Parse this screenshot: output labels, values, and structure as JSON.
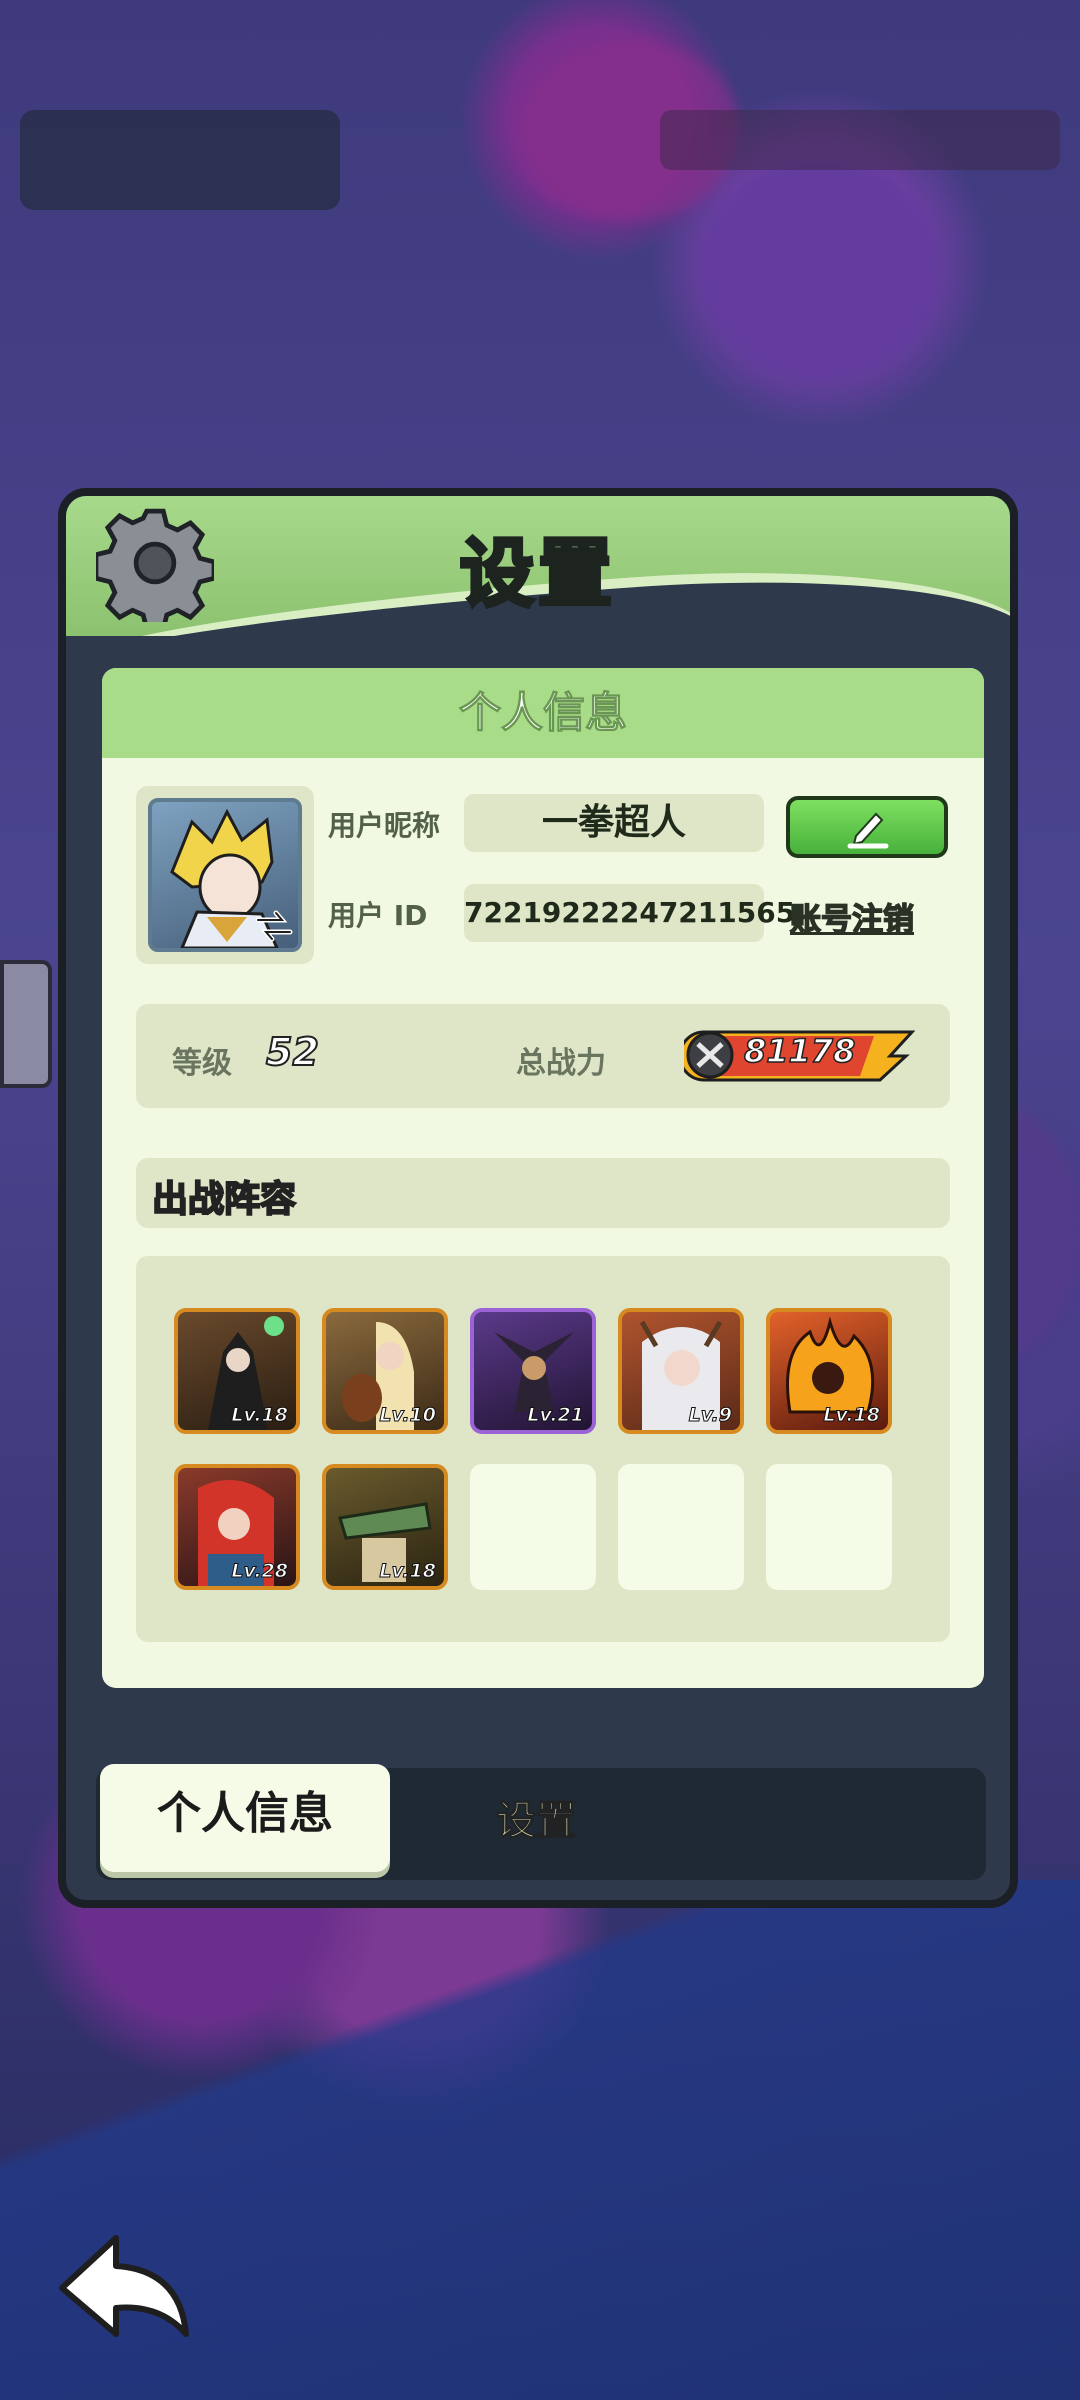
{
  "header": {
    "title": "设置"
  },
  "content": {
    "section_title": "个人信息",
    "profile": {
      "nickname_label": "用户昵称",
      "nickname": "一拳超人",
      "id_label": "用户 ID",
      "user_id": "72219222247211565",
      "account_cancel_label": "账号注销",
      "edit_icon": "pencil-icon"
    },
    "stats": {
      "level_label": "等级",
      "level": "52",
      "power_label": "总战力",
      "power": "81178"
    },
    "lineup": {
      "title": "出战阵容",
      "heroes": [
        {
          "level": "Lv.18",
          "rarity": "orange"
        },
        {
          "level": "Lv.10",
          "rarity": "orange"
        },
        {
          "level": "Lv.21",
          "rarity": "purple"
        },
        {
          "level": "Lv.9",
          "rarity": "orange"
        },
        {
          "level": "Lv.18",
          "rarity": "orange"
        },
        {
          "level": "Lv.28",
          "rarity": "orange"
        },
        {
          "level": "Lv.18",
          "rarity": "orange"
        }
      ],
      "empty_slots": 3
    }
  },
  "tabs": {
    "active": "个人信息",
    "inactive": "设置"
  },
  "colors": {
    "header_green": "#a7d98b",
    "panel_dark": "#2e3a4c",
    "content_bg": "#f2f9e2",
    "edit_button": "#47b13b",
    "orange_frame": "#d68a1f",
    "purple_frame": "#9a63d6"
  }
}
